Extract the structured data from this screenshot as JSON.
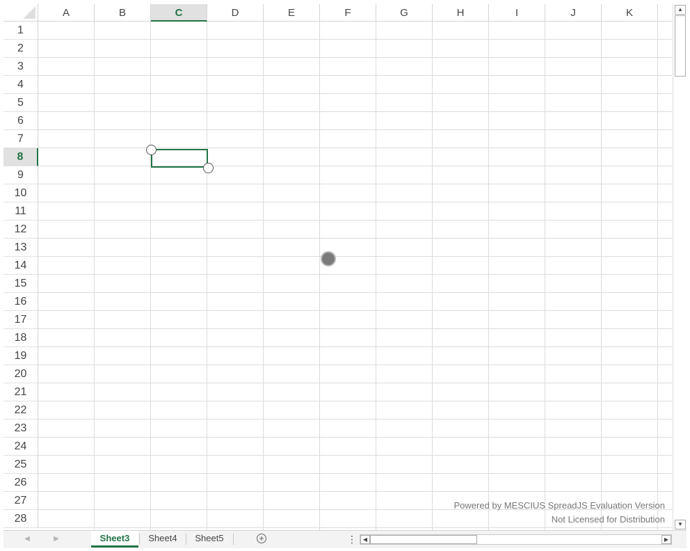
{
  "spreadsheet": {
    "columns": [
      "A",
      "B",
      "C",
      "D",
      "E",
      "F",
      "G",
      "H",
      "I",
      "J",
      "K"
    ],
    "active_column": "C",
    "rows": [
      "1",
      "2",
      "3",
      "4",
      "5",
      "6",
      "7",
      "8",
      "9",
      "10",
      "11",
      "12",
      "13",
      "14",
      "15",
      "16",
      "17",
      "18",
      "19",
      "20",
      "21",
      "22",
      "23",
      "24",
      "25",
      "26",
      "27",
      "28"
    ],
    "active_row": "8",
    "selected_cell": "C8"
  },
  "watermark": {
    "line1": "Powered by MESCIUS SpreadJS Evaluation Version",
    "line2": "Not Licensed for Distribution"
  },
  "sheet_tabs": [
    {
      "label": "Sheet3",
      "active": true
    },
    {
      "label": "Sheet4",
      "active": false
    },
    {
      "label": "Sheet5",
      "active": false
    }
  ],
  "icons": {
    "add_sheet": "plus-circle-icon",
    "nav_first": "nav-left-icon",
    "nav_next": "nav-right-icon",
    "splitter": "vertical-ellipsis-icon",
    "scroll_up": "scroll-up-icon",
    "scroll_down": "scroll-down-icon",
    "scroll_left": "scroll-left-icon",
    "scroll_right": "scroll-right-icon"
  },
  "colors": {
    "accent": "#217346",
    "header_active_bg": "#e1e1e1",
    "gridline": "#dcdcdc"
  }
}
